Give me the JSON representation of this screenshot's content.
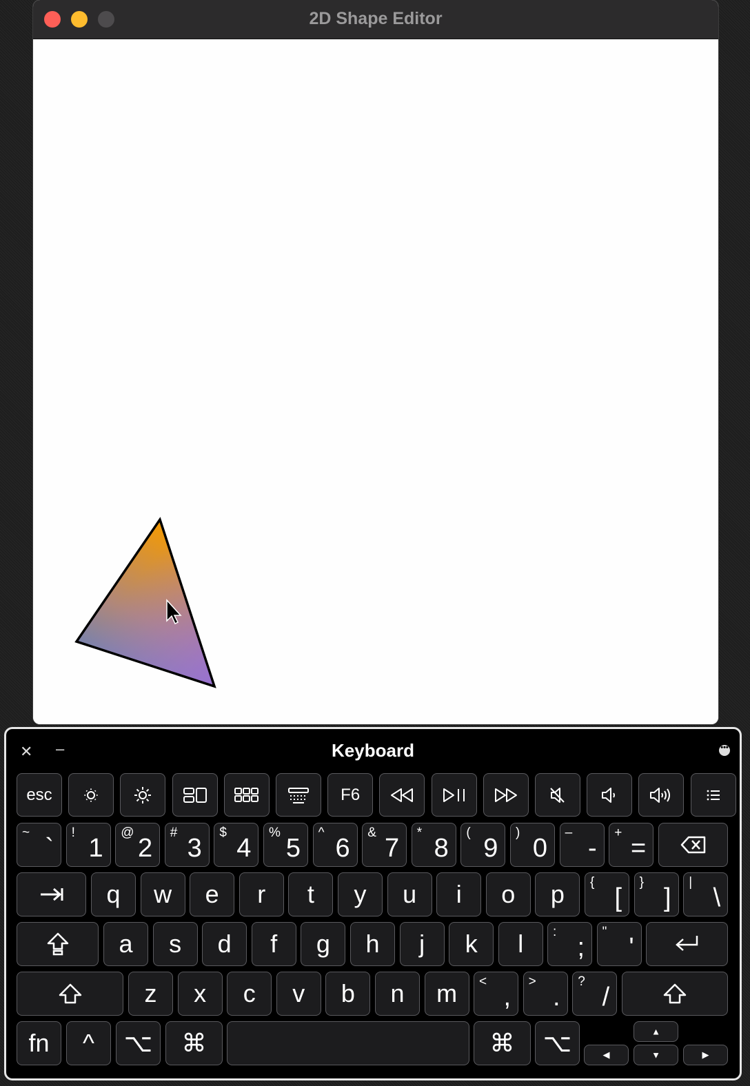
{
  "window": {
    "title": "2D Shape Editor"
  },
  "canvas": {
    "shape": "triangle",
    "gradient": [
      "#f39c00",
      "#5b7fc7",
      "#9f72d8"
    ],
    "stroke": "#000000"
  },
  "keyboard": {
    "title": "Keyboard",
    "close_glyph": "✕",
    "minimize_glyph": "–",
    "more_glyph": "•••",
    "fn_row": [
      "esc",
      "brightness-down-icon",
      "brightness-up-icon",
      "mission-control-icon",
      "launchpad-icon",
      "keyboard-backlight-icon",
      "F6",
      "rewind-icon",
      "play-pause-icon",
      "fast-forward-icon",
      "mute-icon",
      "volume-down-icon",
      "volume-up-icon",
      "list-icon"
    ],
    "fn6_label": "F6",
    "esc_label": "esc",
    "number_row": [
      {
        "shift": "~",
        "main": "`"
      },
      {
        "shift": "!",
        "main": "1"
      },
      {
        "shift": "@",
        "main": "2"
      },
      {
        "shift": "#",
        "main": "3"
      },
      {
        "shift": "$",
        "main": "4"
      },
      {
        "shift": "%",
        "main": "5"
      },
      {
        "shift": "^",
        "main": "6"
      },
      {
        "shift": "&",
        "main": "7"
      },
      {
        "shift": "*",
        "main": "8"
      },
      {
        "shift": "(",
        "main": "9"
      },
      {
        "shift": ")",
        "main": "0"
      },
      {
        "shift": "–",
        "main": "-"
      },
      {
        "shift": "+",
        "main": "="
      }
    ],
    "row_q": [
      "q",
      "w",
      "e",
      "r",
      "t",
      "y",
      "u",
      "i",
      "o",
      "p"
    ],
    "row_q_extra": [
      {
        "shift": "{",
        "main": "["
      },
      {
        "shift": "}",
        "main": "]"
      },
      {
        "shift": "|",
        "main": "\\"
      }
    ],
    "row_a": [
      "a",
      "s",
      "d",
      "f",
      "g",
      "h",
      "j",
      "k",
      "l"
    ],
    "row_a_extra": [
      {
        "shift": ":",
        "main": ";"
      },
      {
        "shift": "\"",
        "main": "'"
      }
    ],
    "row_z": [
      "z",
      "x",
      "c",
      "v",
      "b",
      "n",
      "m"
    ],
    "row_z_extra": [
      {
        "shift": "<",
        "main": ","
      },
      {
        "shift": ">",
        "main": "."
      },
      {
        "shift": "?",
        "main": "/"
      }
    ],
    "bottom": {
      "fn": "fn",
      "control": "^",
      "option": "⌥",
      "command": "⌘",
      "up": "▲",
      "down": "▼",
      "left": "◀",
      "right": "▶"
    }
  }
}
